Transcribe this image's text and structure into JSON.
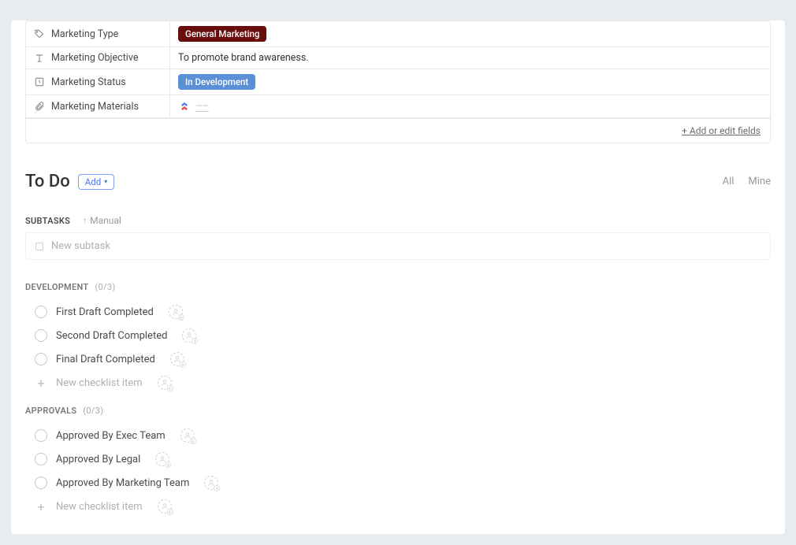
{
  "fields": [
    {
      "icon": "tag-icon",
      "label": "Marketing Type",
      "type": "badge",
      "value": "General Marketing",
      "badgeClass": "badge-dark"
    },
    {
      "icon": "text-icon",
      "label": "Marketing Objective",
      "type": "text",
      "value": "To promote brand awareness."
    },
    {
      "icon": "status-icon",
      "label": "Marketing Status",
      "type": "badge",
      "value": "In Development",
      "badgeClass": "badge-blue"
    },
    {
      "icon": "attach-icon",
      "label": "Marketing Materials",
      "type": "attachment",
      "value": "——"
    }
  ],
  "add_fields_label": "+ Add or edit fields",
  "todo": {
    "title": "To Do",
    "add_label": "Add",
    "filters": {
      "all": "All",
      "mine": "Mine"
    }
  },
  "subtasks": {
    "label": "SUBTASKS",
    "sort": "Manual",
    "new_placeholder": "New subtask"
  },
  "checklist_groups": [
    {
      "title": "DEVELOPMENT",
      "count": "(0/3)",
      "items": [
        "First Draft Completed",
        "Second Draft Completed",
        "Final Draft Completed"
      ],
      "new_label": "New checklist item"
    },
    {
      "title": "APPROVALS",
      "count": "(0/3)",
      "items": [
        "Approved By Exec Team",
        "Approved By Legal",
        "Approved By Marketing Team"
      ],
      "new_label": "New checklist item"
    }
  ]
}
